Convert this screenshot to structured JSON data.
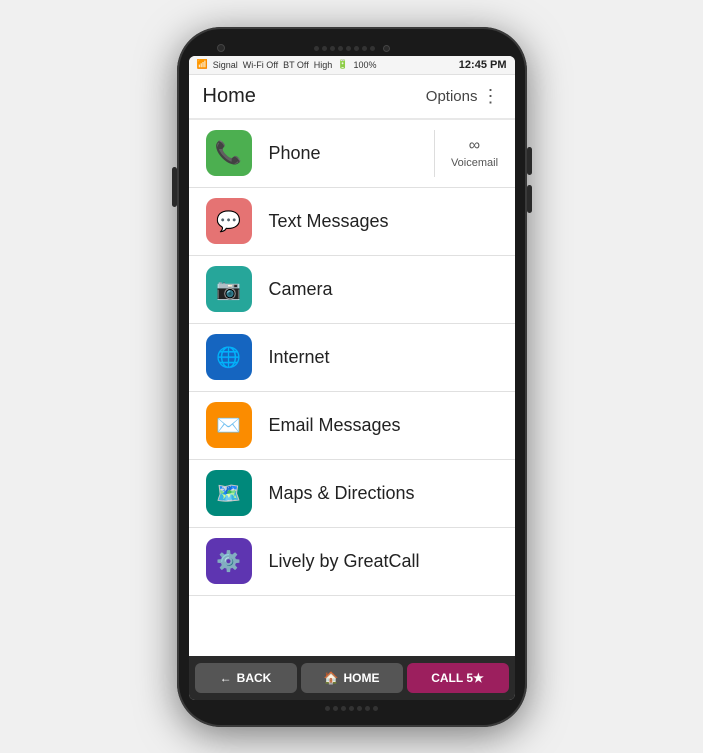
{
  "status": {
    "signal": "Signal",
    "wifi": "Wi-Fi Off",
    "bt": "BT Off",
    "volume": "High",
    "battery": "100%",
    "time": "12:45 PM"
  },
  "header": {
    "title": "Home",
    "options_label": "Options"
  },
  "menu": {
    "items": [
      {
        "id": "phone",
        "label": "Phone",
        "icon": "📞",
        "icon_class": "icon-green",
        "has_voicemail": true,
        "voicemail_label": "Voicemail"
      },
      {
        "id": "text-messages",
        "label": "Text Messages",
        "icon": "💬",
        "icon_class": "icon-red",
        "has_voicemail": false
      },
      {
        "id": "camera",
        "label": "Camera",
        "icon": "📷",
        "icon_class": "icon-teal",
        "has_voicemail": false
      },
      {
        "id": "internet",
        "label": "Internet",
        "icon": "🌐",
        "icon_class": "icon-blue",
        "has_voicemail": false
      },
      {
        "id": "email",
        "label": "Email Messages",
        "icon": "✉️",
        "icon_class": "icon-orange",
        "has_voicemail": false
      },
      {
        "id": "maps",
        "label": "Maps & Directions",
        "icon": "🗺️",
        "icon_class": "icon-teal2",
        "has_voicemail": false
      },
      {
        "id": "lively",
        "label": "Lively by GreatCall",
        "icon": "⚙️",
        "icon_class": "icon-purple",
        "has_voicemail": false
      }
    ]
  },
  "nav": {
    "back_label": "BACK",
    "home_label": "HOME",
    "call_label": "CALL 5★"
  }
}
